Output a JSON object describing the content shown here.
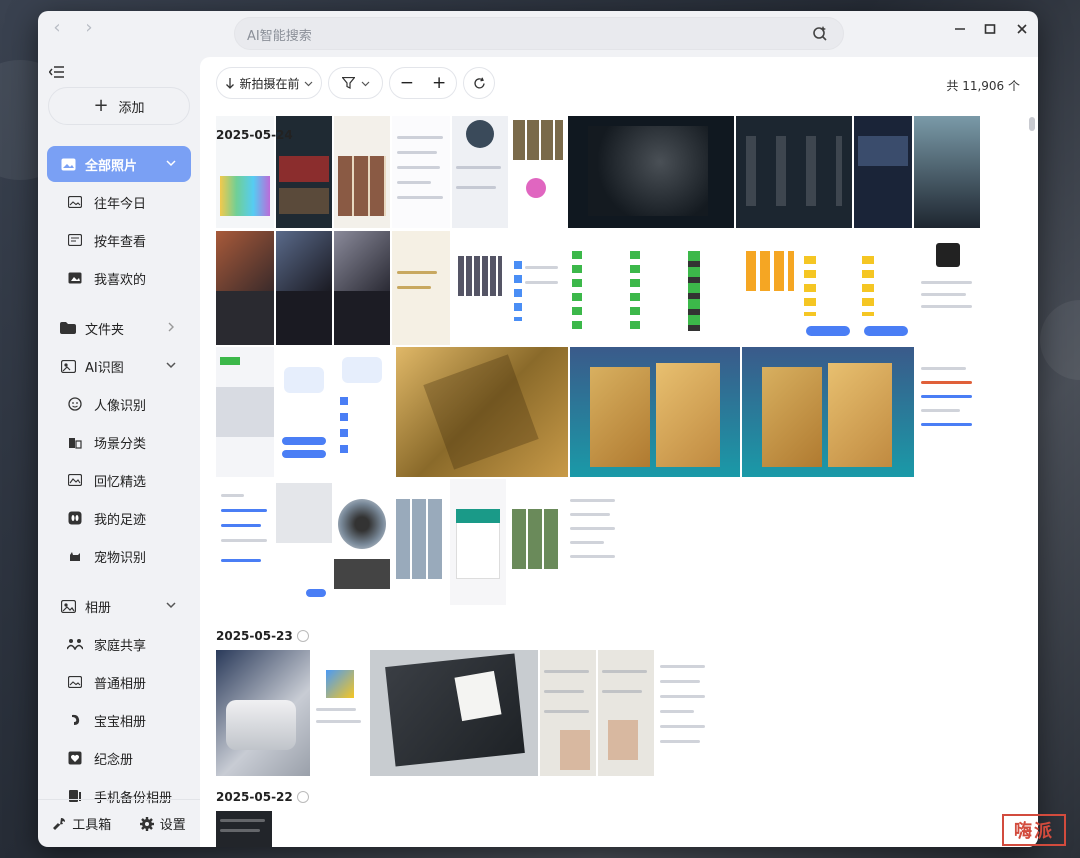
{
  "search": {
    "placeholder": "AI智能搜索"
  },
  "sidebar": {
    "add_label": "添加",
    "items": [
      {
        "label": "全部照片",
        "icon": "photo-icon"
      },
      {
        "label": "往年今日",
        "icon": "image-icon"
      },
      {
        "label": "按年查看",
        "icon": "calendar-icon"
      },
      {
        "label": "我喜欢的",
        "icon": "heart-image-icon"
      },
      {
        "label": "文件夹",
        "icon": "folder-icon"
      },
      {
        "label": "AI识图",
        "icon": "ai-image-icon"
      },
      {
        "label": "人像识别",
        "icon": "face-icon"
      },
      {
        "label": "场景分类",
        "icon": "scene-icon"
      },
      {
        "label": "回忆精选",
        "icon": "memory-icon"
      },
      {
        "label": "我的足迹",
        "icon": "footprint-icon"
      },
      {
        "label": "宠物识别",
        "icon": "pet-icon"
      },
      {
        "label": "相册",
        "icon": "album-icon"
      },
      {
        "label": "家庭共享",
        "icon": "family-icon"
      },
      {
        "label": "普通相册",
        "icon": "normal-album-icon"
      },
      {
        "label": "宝宝相册",
        "icon": "baby-icon"
      },
      {
        "label": "纪念册",
        "icon": "memorial-icon"
      },
      {
        "label": "手机备份相册",
        "icon": "phone-backup-icon"
      }
    ],
    "tools_label": "工具箱",
    "settings_label": "设置"
  },
  "toolbar": {
    "sort_label": "新拍摄在前",
    "filter_label": "",
    "zoom_out": "−",
    "zoom_in": "+"
  },
  "count_text": "共 11,906 个",
  "groups": [
    {
      "date": "2025-05-24"
    },
    {
      "date": "2025-05-23"
    },
    {
      "date": "2025-05-22"
    }
  ],
  "watermark_text": "嗨派",
  "colors": {
    "accent": "#7aa0f4",
    "watermark": "#d24b3d"
  }
}
